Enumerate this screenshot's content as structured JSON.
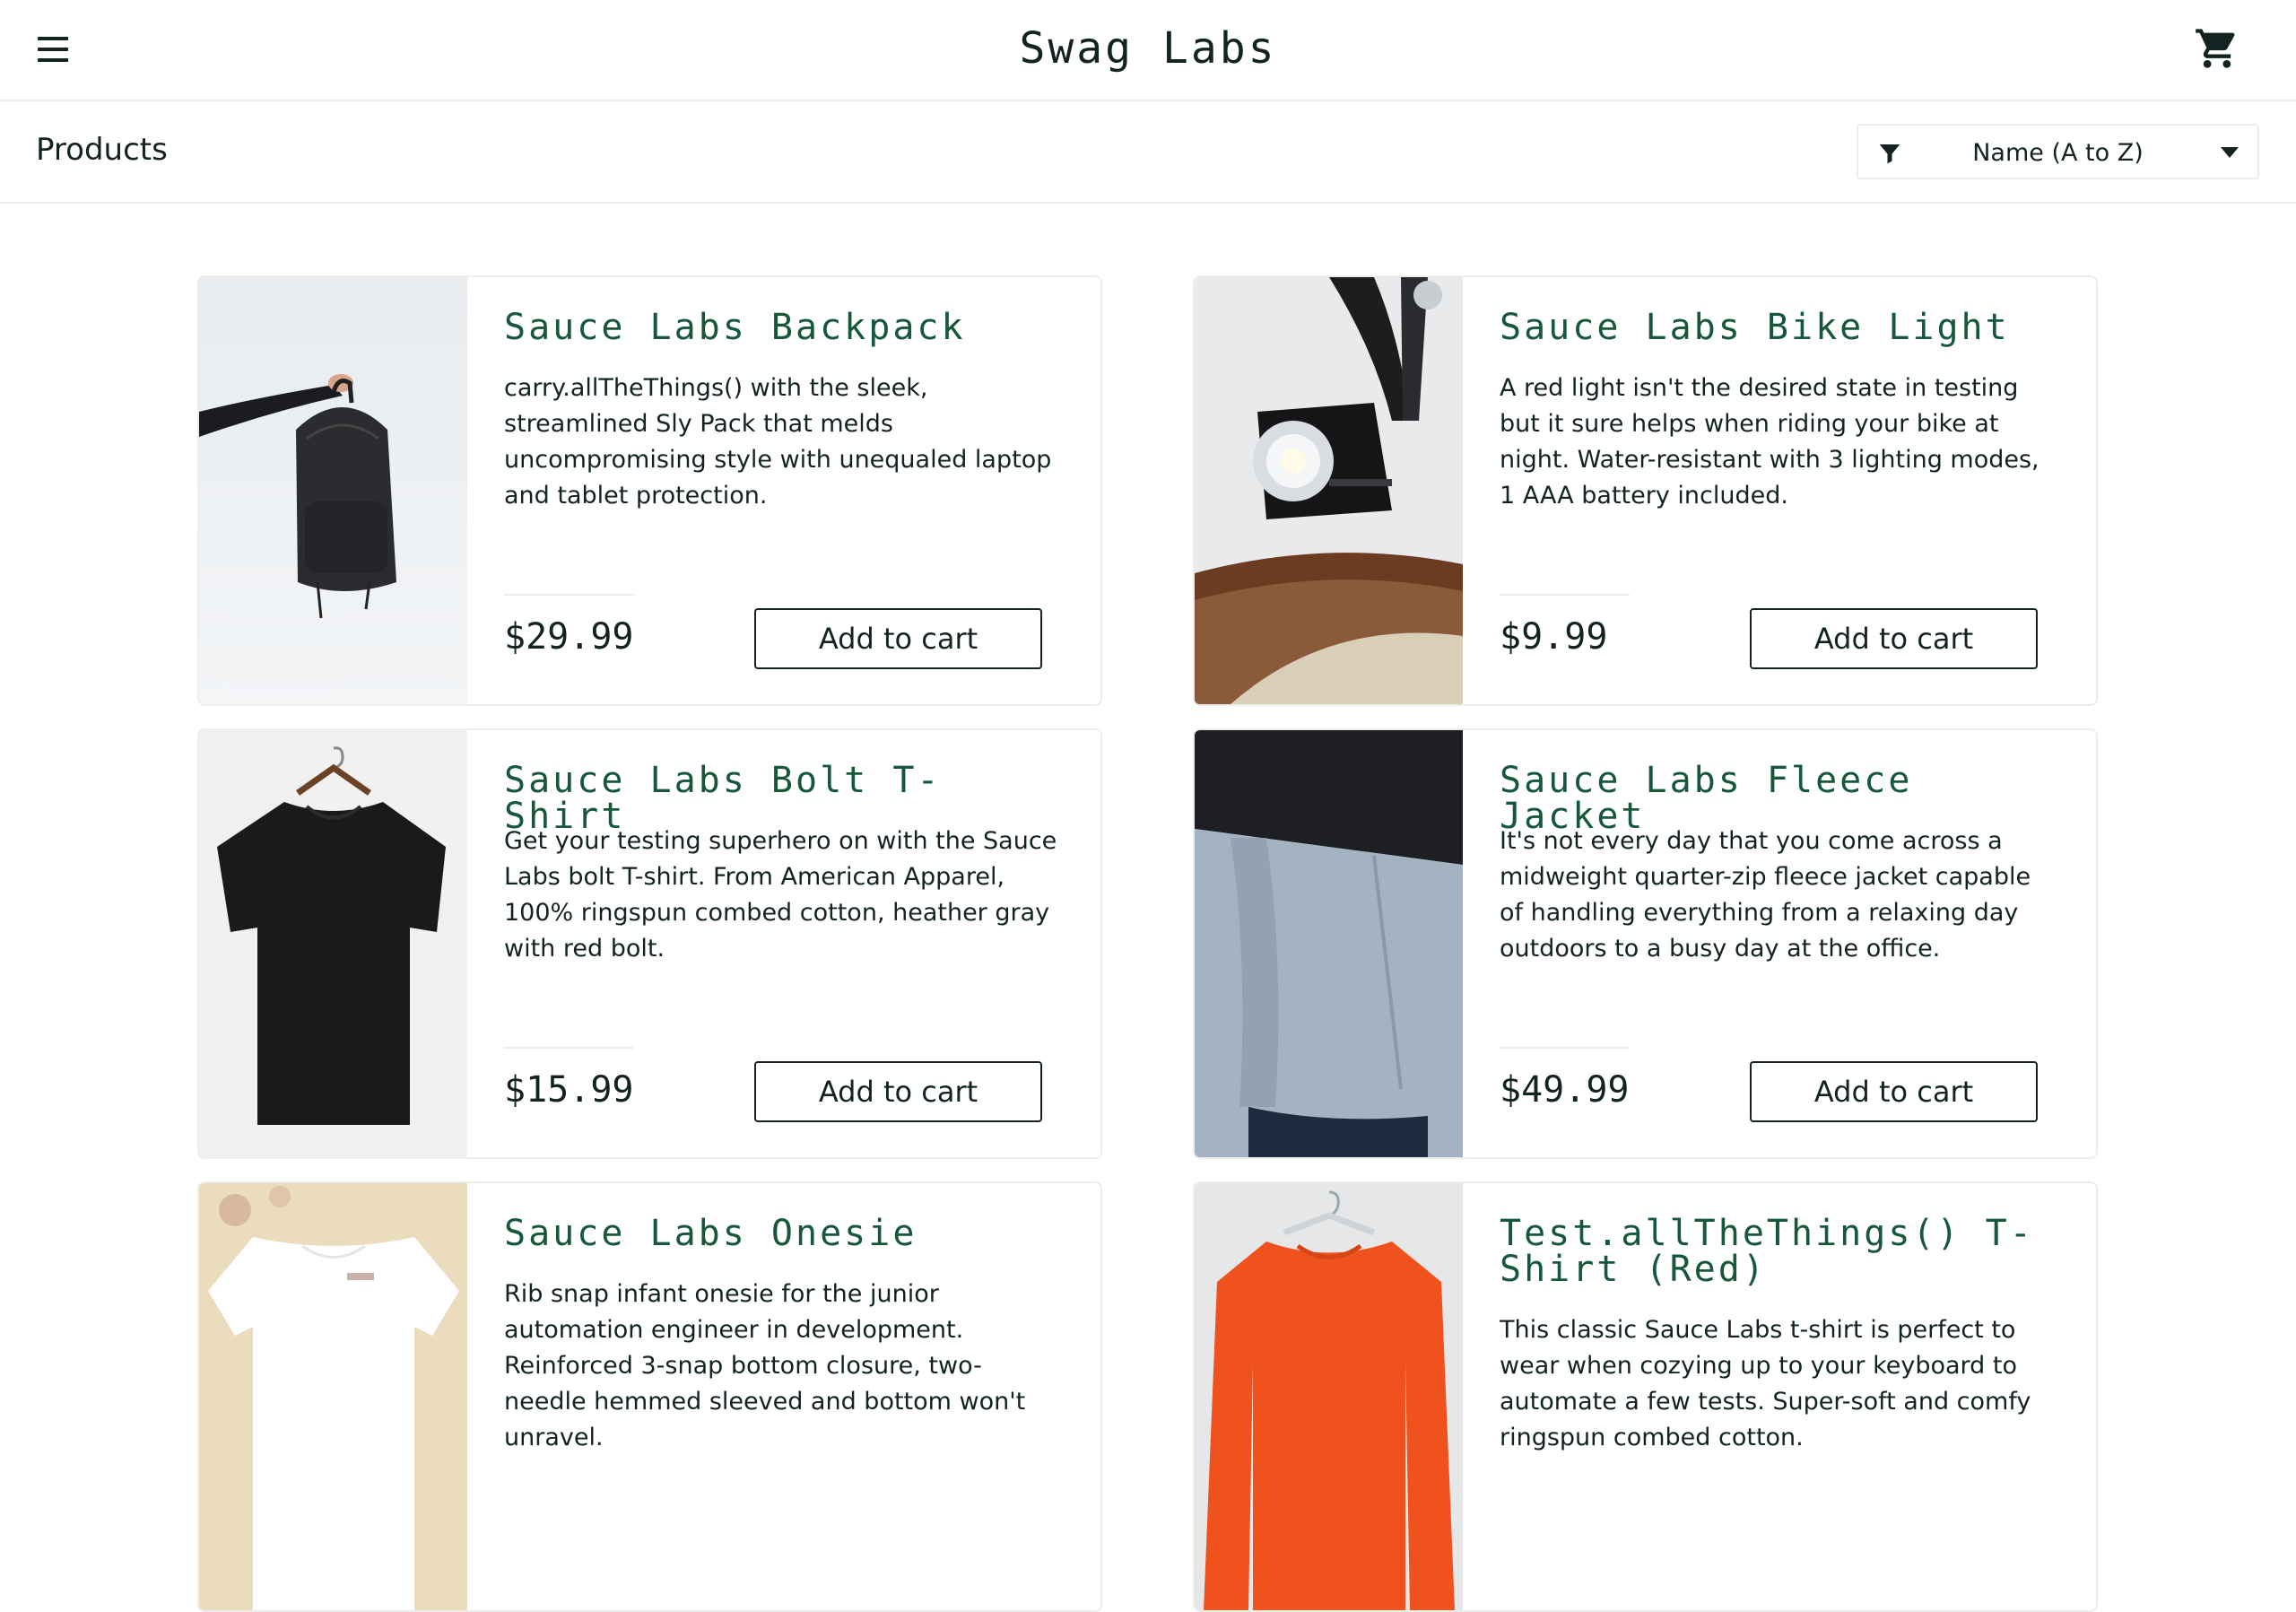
{
  "header": {
    "title": "Swag Labs",
    "menu_icon": "menu-icon",
    "cart_icon": "cart-icon"
  },
  "subheader": {
    "title": "Products",
    "sort": {
      "selected": "Name (A to Z)",
      "icon": "filter-icon"
    }
  },
  "colors": {
    "product_name": "#18583a",
    "text": "#132322",
    "border": "#ededed"
  },
  "products": [
    {
      "name": "Sauce Labs Backpack",
      "description": "carry.allTheThings() with the sleek, streamlined Sly Pack that melds uncompromising style with unequaled laptop and tablet protection.",
      "price": "$29.99",
      "button": "Add to cart"
    },
    {
      "name": "Sauce Labs Bike Light",
      "description": "A red light isn't the desired state in testing but it sure helps when riding your bike at night. Water-resistant with 3 lighting modes, 1 AAA battery included.",
      "price": "$9.99",
      "button": "Add to cart"
    },
    {
      "name": "Sauce Labs Bolt T-Shirt",
      "description": "Get your testing superhero on with the Sauce Labs bolt T-shirt. From American Apparel, 100% ringspun combed cotton, heather gray with red bolt.",
      "price": "$15.99",
      "button": "Add to cart"
    },
    {
      "name": "Sauce Labs Fleece Jacket",
      "description": "It's not every day that you come across a midweight quarter-zip fleece jacket capable of handling everything from a relaxing day outdoors to a busy day at the office.",
      "price": "$49.99",
      "button": "Add to cart"
    },
    {
      "name": "Sauce Labs Onesie",
      "description": "Rib snap infant onesie for the junior automation engineer in development. Reinforced 3-snap bottom closure, two-needle hemmed sleeved and bottom won't unravel.",
      "price": "",
      "button": ""
    },
    {
      "name": "Test.allTheThings() T-Shirt (Red)",
      "description": "This classic Sauce Labs t-shirt is perfect to wear when cozying up to your keyboard to automate a few tests. Super-soft and comfy ringspun combed cotton.",
      "price": "",
      "button": ""
    }
  ]
}
